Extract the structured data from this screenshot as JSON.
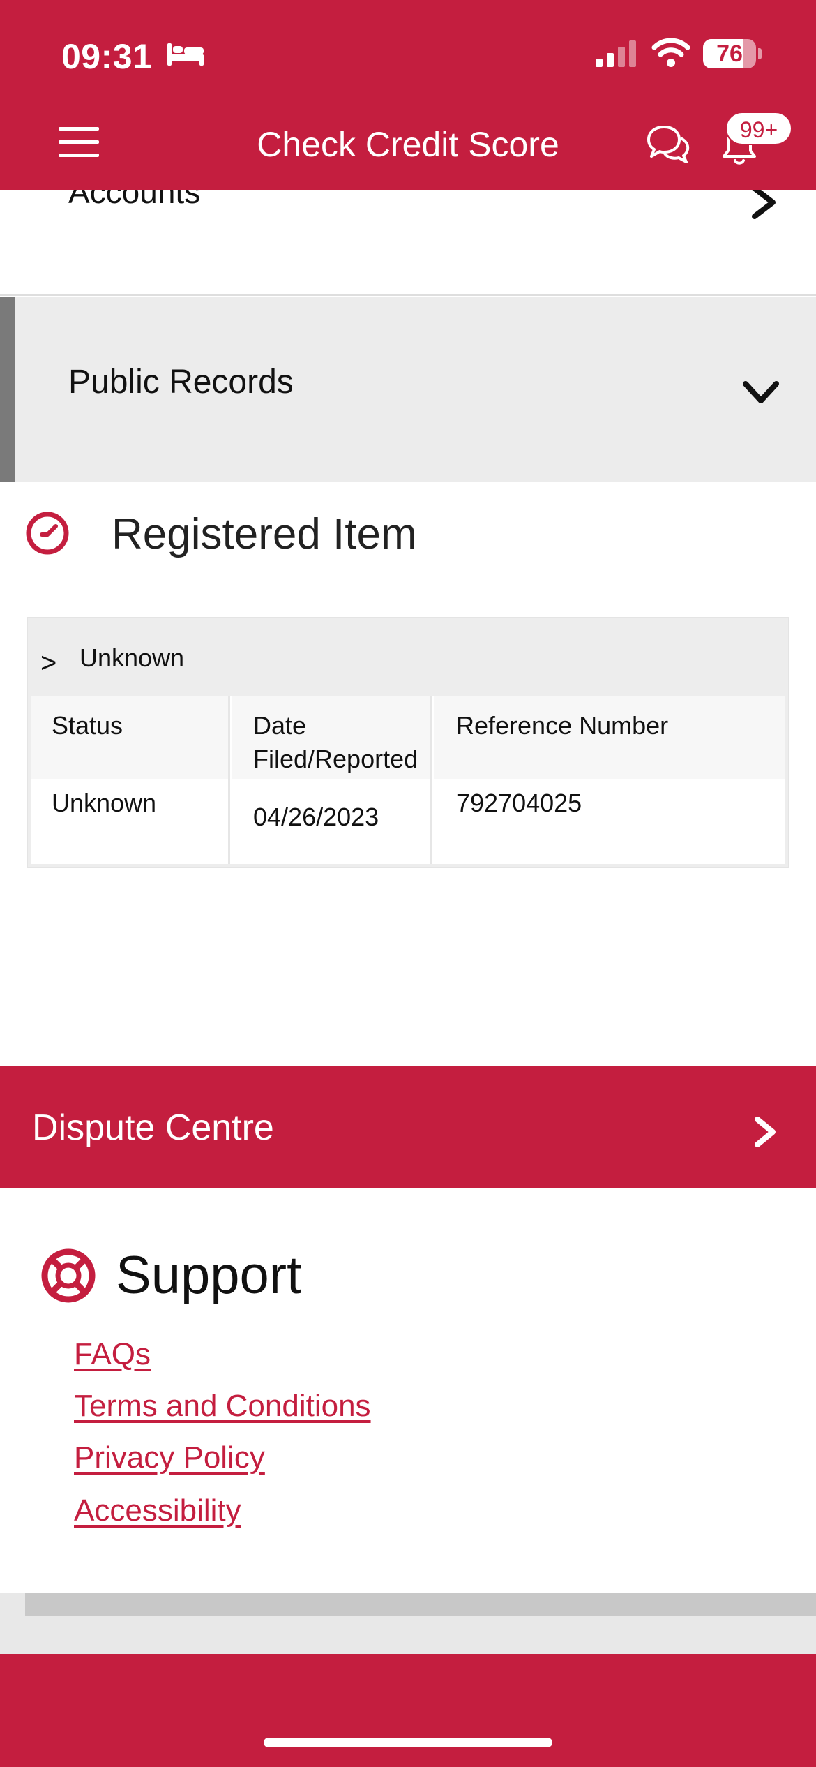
{
  "status_bar": {
    "time": "09:31",
    "battery": "76",
    "battery_level": 0.76
  },
  "header": {
    "title": "Check Credit Score",
    "badge": "99+",
    "icons": [
      "menu-icon",
      "chat-icon",
      "bell-icon"
    ]
  },
  "sections": {
    "accounts": "Accounts",
    "public_records": "Public Records"
  },
  "registered_item": {
    "title": "Registered Item",
    "card_heading": "Unknown",
    "caret": ">",
    "columns": [
      "Status",
      "Date Filed/Reported",
      "Reference Number"
    ],
    "row": [
      "Unknown",
      "04/26/2023",
      "792704025"
    ]
  },
  "dispute": {
    "label": "Dispute Centre"
  },
  "support": {
    "title": "Support",
    "links": [
      "FAQs",
      "Terms and Conditions",
      "Privacy Policy",
      "Accessibility"
    ]
  },
  "colors": {
    "brand": "#c41e3f",
    "panel": "#ececec",
    "text": "#111111"
  }
}
